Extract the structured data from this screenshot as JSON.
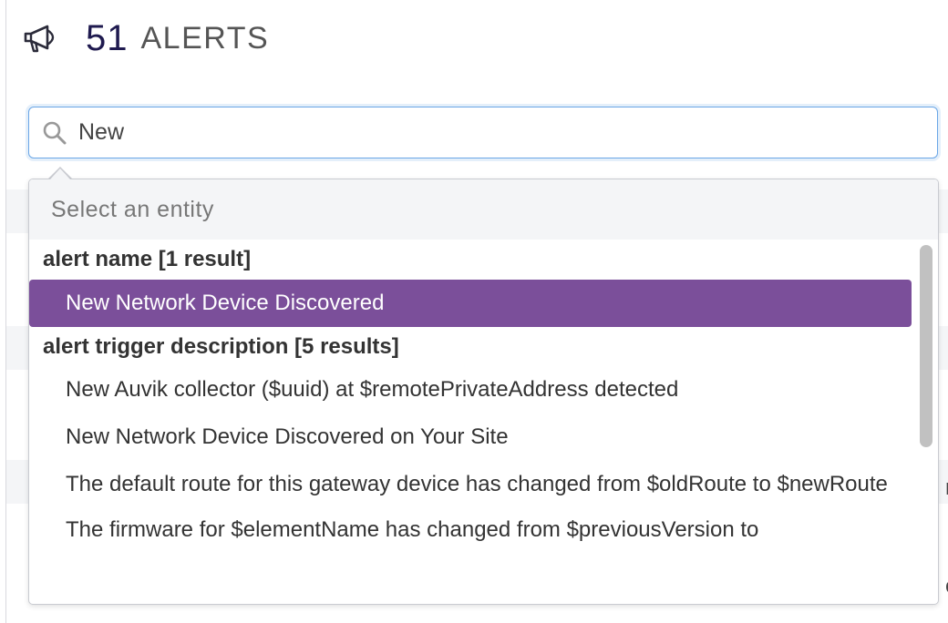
{
  "header": {
    "icon": "megaphone-icon",
    "count": "51",
    "title": "ALERTS"
  },
  "search": {
    "icon": "search-icon",
    "value": "New"
  },
  "dropdown": {
    "header": "Select an entity",
    "groups": [
      {
        "label": "alert name [1 result]",
        "items": [
          {
            "label": "New Network Device Discovered",
            "selected": true
          }
        ]
      },
      {
        "label": "alert trigger description [5 results]",
        "items": [
          {
            "label": "New Auvik collector ($uuid) at $remotePrivateAddress detected"
          },
          {
            "label": "New Network Device Discovered on Your Site"
          },
          {
            "label": "The default route for this gateway device has changed from $oldRoute to $newRoute"
          },
          {
            "label": "The firmware for $elementName has changed from $previousVersion to"
          }
        ]
      }
    ]
  },
  "background_edges": [
    "n",
    "e"
  ],
  "colors": {
    "accent": "#7b4f9a",
    "focus_border": "#6aa6e6",
    "title_count": "#1f1a4f"
  }
}
